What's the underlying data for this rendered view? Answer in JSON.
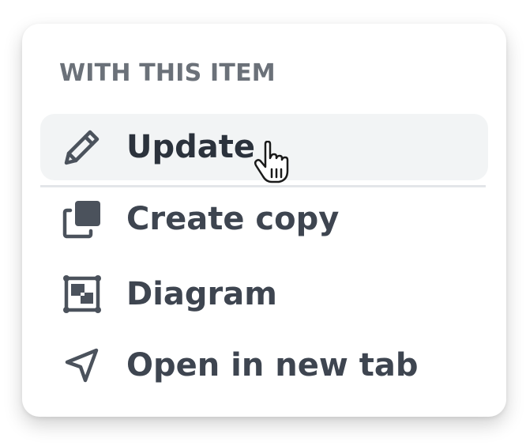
{
  "menu": {
    "section_label": "WITH THIS ITEM",
    "items": [
      {
        "label": "Update",
        "icon": "pencil-icon",
        "active": true
      },
      {
        "label": "Create copy",
        "icon": "copy-icon",
        "active": false
      },
      {
        "label": "Diagram",
        "icon": "diagram-icon",
        "active": false
      },
      {
        "label": "Open in new tab",
        "icon": "navigation-arrow-icon",
        "active": false
      }
    ]
  },
  "colors": {
    "icon": "#4b525c",
    "text": "#3e4550",
    "section_label": "#6b7179",
    "hover_bg": "#f2f4f5"
  }
}
